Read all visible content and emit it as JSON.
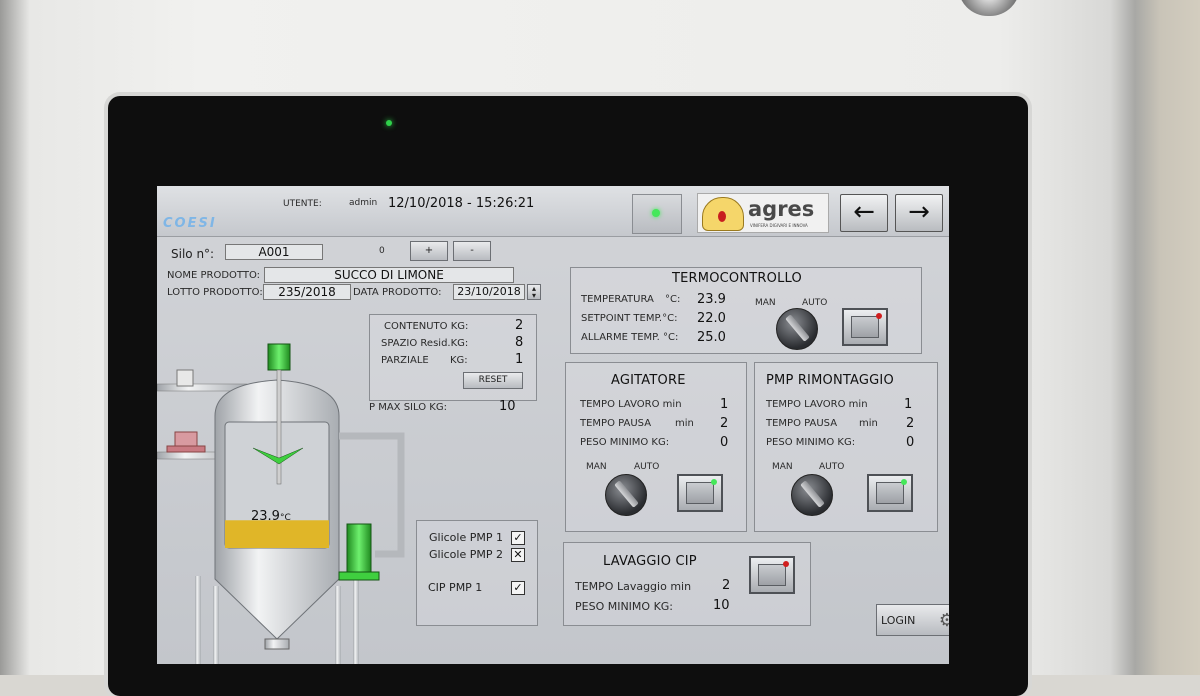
{
  "header": {
    "brand": "COESI",
    "user_label": "UTENTE:",
    "user_value": "admin",
    "datetime": "12/10/2018 - 15:26:21",
    "logo_text": "agres",
    "logo_tagline": "VINIFERA DIGIVARI E INNOVA",
    "back_icon": "←",
    "forward_icon": "→"
  },
  "silo": {
    "label": "Silo n°:",
    "value": "A001",
    "counter": "0",
    "plus_label": "+",
    "minus_label": "-"
  },
  "product": {
    "name_label": "NOME PRODOTTO:",
    "name_value": "SUCCO DI LIMONE",
    "lot_label": "LOTTO PRODOTTO:",
    "lot_value": "235/2018",
    "date_label": "DATA PRODOTTO:",
    "date_value": "23/10/2018"
  },
  "content": {
    "rows": [
      {
        "label": "CONTENUTO KG:",
        "value": "2"
      },
      {
        "label": "SPAZIO Resid.KG:",
        "value": "8"
      },
      {
        "label": "PARZIALE",
        "unit": "KG:",
        "value": "1"
      }
    ],
    "reset_label": "RESET",
    "pmax_label": "P MAX SILO KG:",
    "pmax_value": "10"
  },
  "tank": {
    "temperature": "23.9",
    "temperature_unit": "°C",
    "fill_fraction": 0.22
  },
  "termocontrollo": {
    "title": "TERMOCONTROLLO",
    "rows": [
      {
        "label": "TEMPERATURA",
        "unit": "°C:",
        "value": "23.9"
      },
      {
        "label": "SETPOINT TEMP.°C:",
        "value": "22.0"
      },
      {
        "label": "ALLARME TEMP. °C:",
        "value": "25.0"
      }
    ],
    "man_label": "MAN",
    "auto_label": "AUTO"
  },
  "agitatore": {
    "title": "AGITATORE",
    "rows": [
      {
        "label": "TEMPO LAVORO min",
        "value": "1"
      },
      {
        "label": "TEMPO PAUSA",
        "unit": "min",
        "value": "2"
      },
      {
        "label": "PESO MINIMO KG:",
        "value": "0"
      }
    ],
    "man_label": "MAN",
    "auto_label": "AUTO"
  },
  "rimontaggio": {
    "title": "PMP RIMONTAGGIO",
    "rows": [
      {
        "label": "TEMPO LAVORO min",
        "value": "1"
      },
      {
        "label": "TEMPO PAUSA",
        "unit": "min",
        "value": "2"
      },
      {
        "label": "PESO MINIMO KG:",
        "value": "0"
      }
    ],
    "man_label": "MAN",
    "auto_label": "AUTO"
  },
  "pumps": {
    "items": [
      {
        "label": "Glicole PMP 1",
        "mark": "✓"
      },
      {
        "label": "Glicole PMP 2",
        "mark": "✕"
      },
      {
        "label": "CIP PMP 1",
        "mark": "✓"
      }
    ]
  },
  "lavaggio": {
    "title": "LAVAGGIO CIP",
    "rows": [
      {
        "label": "TEMPO Lavaggio min",
        "value": "2"
      },
      {
        "label": "PESO MINIMO KG:",
        "value": "10"
      }
    ]
  },
  "login_label": "LOGIN",
  "colors": {
    "led_green": "#2fd04a",
    "led_red": "#d01e1e",
    "tank_liquid": "#e0b628",
    "pipe_green": "#3fcf3f"
  }
}
